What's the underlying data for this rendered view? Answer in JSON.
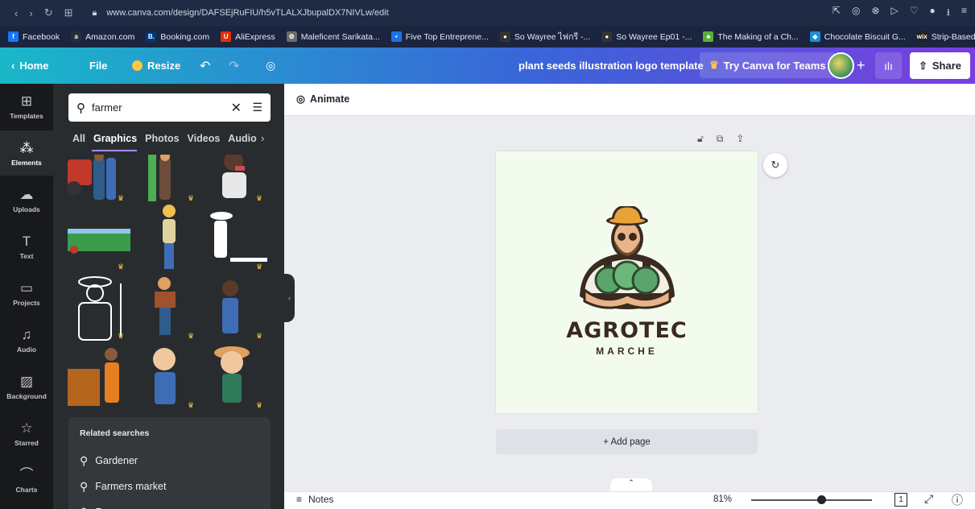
{
  "browser": {
    "url": "www.canva.com/design/DAFSEjRuFIU/h5vTLALXJbupalDX7NIVLw/edit",
    "bookmarks": [
      {
        "label": "Facebook",
        "icon": "facebook-icon",
        "color": "#1877f2",
        "glyph": "f"
      },
      {
        "label": "Amazon.com",
        "icon": "amazon-icon",
        "color": "#232f3e",
        "glyph": "a"
      },
      {
        "label": "Booking.com",
        "icon": "booking-icon",
        "color": "#003580",
        "glyph": "B."
      },
      {
        "label": "AliExpress",
        "icon": "aliexpress-icon",
        "color": "#e62e04",
        "glyph": "U"
      },
      {
        "label": "Maleficent Sarikata...",
        "icon": "site-icon",
        "color": "#6b6b6b",
        "glyph": "⚙"
      },
      {
        "label": "Five Top Entreprene...",
        "icon": "site-icon",
        "color": "#1a73e8",
        "glyph": "•"
      },
      {
        "label": "So Wayree ไฟกรี -...",
        "icon": "site-icon",
        "color": "#333",
        "glyph": "●"
      },
      {
        "label": "So Wayree Ep01 -...",
        "icon": "site-icon",
        "color": "#333",
        "glyph": "●"
      },
      {
        "label": "The Making of a Ch...",
        "icon": "leaf-icon",
        "color": "#58b033",
        "glyph": "♣"
      },
      {
        "label": "Chocolate Biscuit G...",
        "icon": "site-icon",
        "color": "#1a8ed8",
        "glyph": "◆"
      },
      {
        "label": "Strip-Based Site We...",
        "icon": "wix-icon",
        "color": "#222",
        "glyph": "wix"
      }
    ]
  },
  "header": {
    "home": "Home",
    "file": "File",
    "resize": "Resize",
    "title": "plant seeds illustration logo template",
    "try_teams": "Try Canva for Teams",
    "share": "Share",
    "accent": "#7a3ee0"
  },
  "rail": [
    {
      "label": "Templates",
      "icon": "templates-icon",
      "glyph": "⊞"
    },
    {
      "label": "Elements",
      "icon": "elements-icon",
      "glyph": "⁂"
    },
    {
      "label": "Uploads",
      "icon": "upload-icon",
      "glyph": "☁"
    },
    {
      "label": "Text",
      "icon": "text-icon",
      "glyph": "T"
    },
    {
      "label": "Projects",
      "icon": "folder-icon",
      "glyph": "▭"
    },
    {
      "label": "Audio",
      "icon": "music-icon",
      "glyph": "♫"
    },
    {
      "label": "Background",
      "icon": "background-icon",
      "glyph": "▨"
    },
    {
      "label": "Starred",
      "icon": "star-icon",
      "glyph": "☆"
    },
    {
      "label": "Charts",
      "icon": "chart-icon",
      "glyph": "⌒"
    }
  ],
  "panel": {
    "search_value": "farmer",
    "tabs": [
      "All",
      "Graphics",
      "Photos",
      "Videos",
      "Audio"
    ],
    "related_title": "Related searches",
    "related": [
      "Gardener",
      "Farmers market",
      "Farm"
    ]
  },
  "editor": {
    "animate": "Animate",
    "brand_main": "AGROTEC",
    "brand_sub": "MARCHE",
    "add_page": "+ Add page",
    "notes": "Notes",
    "zoom": "81%",
    "zoom_level": 0.58,
    "page_number": "1"
  }
}
